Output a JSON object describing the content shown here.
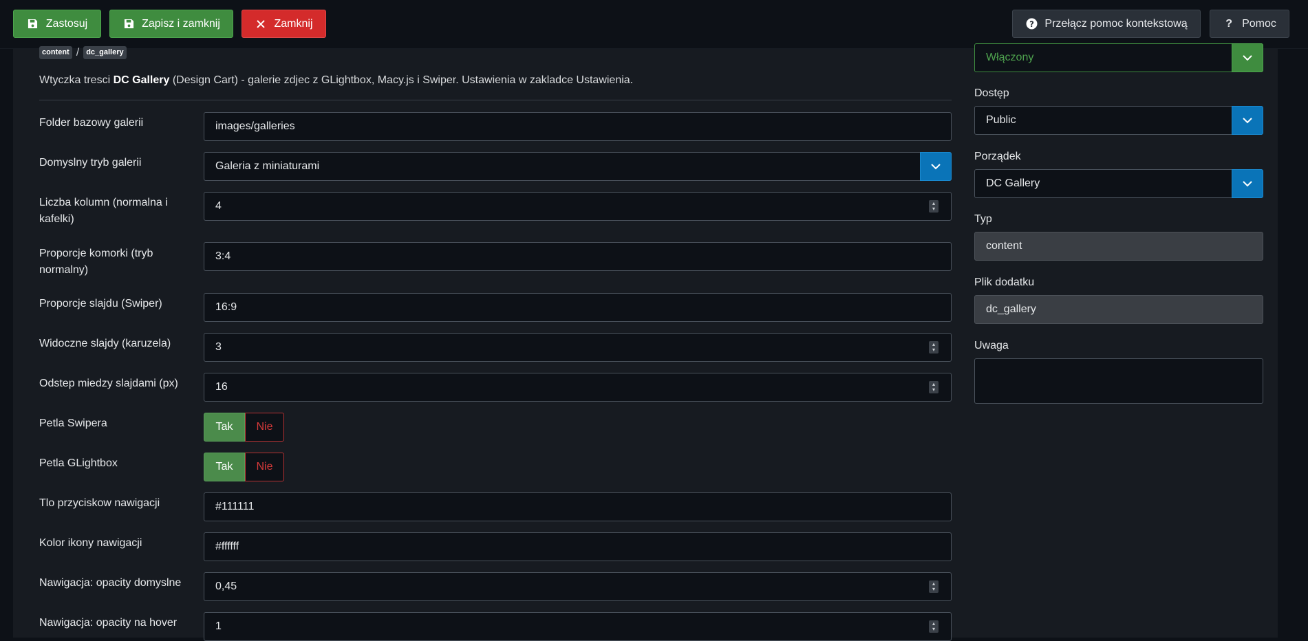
{
  "toolbar": {
    "apply_label": "Zastosuj",
    "save_close_label": "Zapisz i zamknij",
    "close_label": "Zamknij",
    "context_help_label": "Przełącz pomoc kontekstową",
    "help_label": "Pomoc"
  },
  "breadcrumb": {
    "group": "content",
    "element": "dc_gallery"
  },
  "description": {
    "prefix": "Wtyczka tresci ",
    "name": "DC Gallery",
    "suffix": " (Design Cart) - galerie zdjec z GLightbox, Macy.js i Swiper. Ustawienia w zakladce Ustawienia."
  },
  "form": {
    "base_folder": {
      "label": "Folder bazowy galerii",
      "value": "images/galleries"
    },
    "default_mode": {
      "label": "Domyslny tryb galerii",
      "value": "Galeria z miniaturami"
    },
    "columns": {
      "label": "Liczba kolumn (normalna i kafelki)",
      "value": "4"
    },
    "cell_ratio": {
      "label": "Proporcje komorki (tryb normalny)",
      "value": "3:4"
    },
    "slide_ratio": {
      "label": "Proporcje slajdu (Swiper)",
      "value": "16:9"
    },
    "visible_slides": {
      "label": "Widoczne slajdy (karuzela)",
      "value": "3"
    },
    "slide_gap": {
      "label": "Odstep miedzy slajdami (px)",
      "value": "16"
    },
    "swiper_loop": {
      "label": "Petla Swipera",
      "yes": "Tak",
      "no": "Nie",
      "selected": "Tak"
    },
    "glightbox_loop": {
      "label": "Petla GLightbox",
      "yes": "Tak",
      "no": "Nie",
      "selected": "Tak"
    },
    "nav_bg": {
      "label": "Tlo przyciskow nawigacji",
      "value": "#111111"
    },
    "nav_icon_color": {
      "label": "Kolor ikony nawigacji",
      "value": "#ffffff"
    },
    "nav_opacity": {
      "label": "Nawigacja: opacity domyslne",
      "value": "0,45"
    },
    "nav_opacity_hover": {
      "label": "Nawigacja: opacity na hover",
      "value": "1"
    }
  },
  "sidebar": {
    "status": {
      "value": "Włączony"
    },
    "access": {
      "label": "Dostęp",
      "value": "Public"
    },
    "ordering": {
      "label": "Porządek",
      "value": "DC Gallery"
    },
    "type": {
      "label": "Typ",
      "value": "content"
    },
    "plugin_file": {
      "label": "Plik dodatku",
      "value": "dc_gallery"
    },
    "note": {
      "label": "Uwaga",
      "value": ""
    }
  },
  "colors": {
    "accent_green": "#3f8c3f",
    "accent_red": "#d42b2b",
    "accent_blue": "#0a74b8",
    "background": "#0d1117"
  },
  "icons": {
    "apply": "floppy-disk-icon",
    "save_close": "floppy-disk-icon",
    "close": "x-icon",
    "context_help": "question-circle-icon",
    "help": "question-icon"
  }
}
